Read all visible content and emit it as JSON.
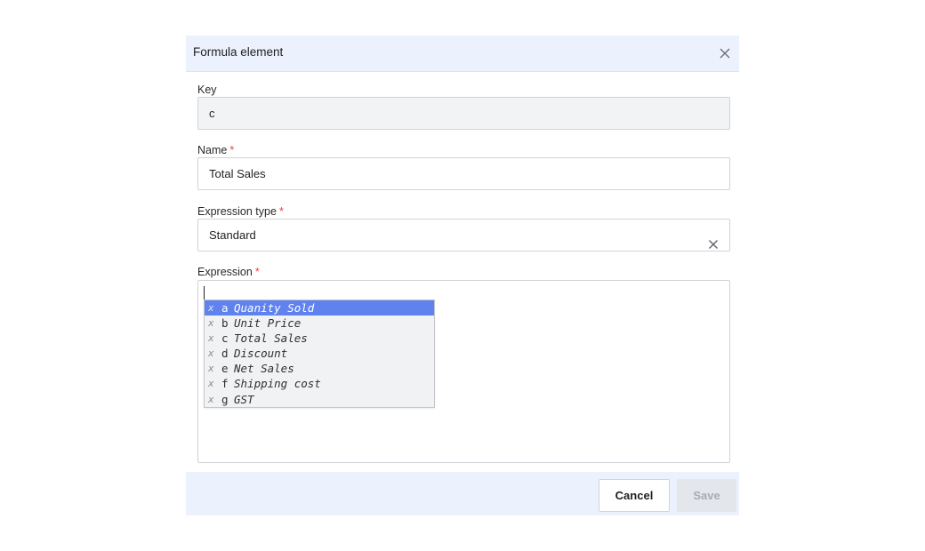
{
  "dialog": {
    "title": "Formula element",
    "close_icon": "close-icon"
  },
  "fields": {
    "key": {
      "label": "Key",
      "value": "c",
      "disabled": true
    },
    "name": {
      "label": "Name",
      "required_mark": "*",
      "value": "Total Sales"
    },
    "expression_type": {
      "label": "Expression type",
      "required_mark": "*",
      "value": "Standard",
      "clear_icon": "clear-icon"
    },
    "expression": {
      "label": "Expression",
      "required_mark": "*",
      "value": ""
    }
  },
  "suggestions": [
    {
      "type": "x",
      "key": "a",
      "name": "Quanity Sold",
      "active": true
    },
    {
      "type": "x",
      "key": "b",
      "name": "Unit Price"
    },
    {
      "type": "x",
      "key": "c",
      "name": "Total Sales"
    },
    {
      "type": "x",
      "key": "d",
      "name": "Discount"
    },
    {
      "type": "x",
      "key": "e",
      "name": "Net Sales"
    },
    {
      "type": "x",
      "key": "f",
      "name": "Shipping cost"
    },
    {
      "type": "x",
      "key": "g",
      "name": "GST"
    }
  ],
  "footer": {
    "cancel_label": "Cancel",
    "save_label": "Save",
    "save_disabled": true
  },
  "colors": {
    "header_bg": "#ecf2fd",
    "active_suggestion": "#5f82ef",
    "required": "#e0474c"
  }
}
